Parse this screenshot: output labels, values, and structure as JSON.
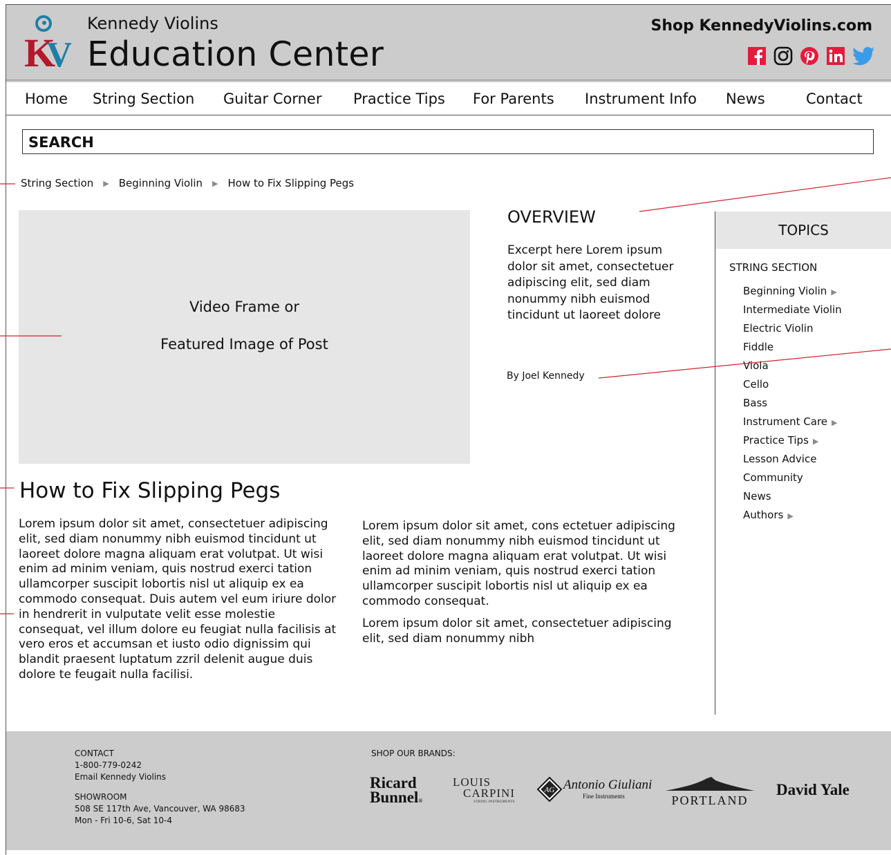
{
  "header": {
    "brand_small": "Kennedy Violins",
    "brand_large": "Education Center",
    "shop_link": "Shop KennedyViolins.com",
    "logo_text": "KV",
    "social": [
      "facebook-icon",
      "instagram-icon",
      "pinterest-icon",
      "linkedin-icon",
      "twitter-icon"
    ],
    "accent_color": "#e31c3d",
    "logo_red": "#b5172b",
    "logo_blue": "#1f7fa6"
  },
  "nav": {
    "items": [
      "Home",
      "String Section",
      "Guitar Corner",
      "Practice Tips",
      "For Parents",
      "Instrument Info",
      "News",
      "Contact"
    ]
  },
  "search": {
    "label": "SEARCH"
  },
  "breadcrumb": [
    "String Section",
    "Beginning Violin",
    "How to Fix Slipping Pegs"
  ],
  "media": {
    "line1": "Video Frame or",
    "line2": "Featured Image of Post"
  },
  "overview": {
    "title": "OVERVIEW",
    "excerpt": "Excerpt here Lorem ipsum dolor sit amet, consec­tetuer adipiscing elit, sed diam nonummy nibh euis­mod tincidunt ut laoreet dolore",
    "author": "By Joel Kennedy"
  },
  "article": {
    "title": "How to Fix Slipping Pegs",
    "col1_p1": "Lorem ipsum dolor sit amet, consectetuer adipisc­ing elit, sed diam nonummy nibh euismod tincid­unt ut laoreet dolore magna aliquam erat volutpat. Ut wisi enim ad minim veniam, quis nostrud exerci tation ullamcorper suscipit lobortis nisl ut aliquip ex ea commodo consequat. Duis autem vel eum iriure dolor in hendrerit in vulputate velit esse mo­lestie consequat, vel illum dolore eu feugiat nulla facilisis at vero eros et accumsan et iusto odio dignissim qui blandit praesent luptatum zzril dele­nit augue duis dolore te feugait nulla facilisi.",
    "col2_p1": "Lorem ipsum dolor sit amet, cons ectetuer adipisc­ing elit, sed diam nonummy nibh euismod tincid­unt ut laoreet dolore magna aliquam erat volutpat. Ut wisi enim ad minim veniam, quis nostrud exerci tation ullamcorper suscipit lobortis nisl ut aliquip ex ea commodo consequat.",
    "col2_p2": "Lorem ipsum dolor sit amet, consectetuer adipisc­ing elit, sed diam nonummy nibh"
  },
  "sidebar": {
    "title": "TOPICS",
    "section": "STRING SECTION",
    "items": [
      {
        "label": "Beginning Violin",
        "arrow": "▶"
      },
      {
        "label": "Intermediate Violin",
        "arrow": ""
      },
      {
        "label": "Electric Violin",
        "arrow": ""
      },
      {
        "label": "Fiddle",
        "arrow": ""
      },
      {
        "label": "Viola",
        "arrow": ""
      },
      {
        "label": "Cello",
        "arrow": ""
      },
      {
        "label": "Bass",
        "arrow": ""
      },
      {
        "label": "Instrument Care",
        "arrow": "▶"
      },
      {
        "label": "Practice Tips",
        "arrow": "▶"
      },
      {
        "label": "Lesson Advice",
        "arrow": ""
      },
      {
        "label": "Community",
        "arrow": ""
      },
      {
        "label": "News",
        "arrow": ""
      },
      {
        "label": "Authors",
        "arrow": "▶"
      }
    ]
  },
  "footer": {
    "contact_label": "CONTACT",
    "phone": "1-800-779-0242",
    "email_link": "Email Kennedy Violins",
    "showroom_label": "SHOWROOM",
    "address": "508 SE 117th Ave, Vancouver, WA 98683",
    "hours": "Mon - Fri 10-6, Sat 10-4",
    "brands_label": "SHOP OUR BRANDS:",
    "brands": {
      "ricard_1": "Ricard",
      "ricard_2": "Bunnel",
      "ricard_mark": "®",
      "louis_1": "LOUIS",
      "louis_2": "CARPINI",
      "louis_3": "STRING INSTRUMENTS",
      "antonio_mark": "AG",
      "antonio_1": "Antonio Giuliani",
      "antonio_2": "Fine Instruments",
      "portland": "PORTLAND",
      "david": "David Yale"
    }
  }
}
